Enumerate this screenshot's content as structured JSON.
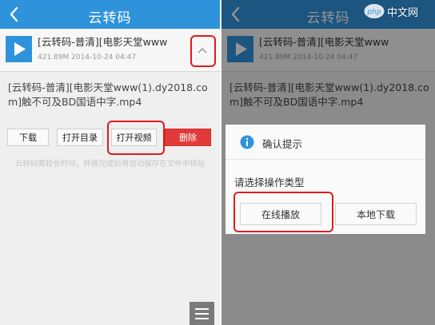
{
  "left_screen": {
    "title": "云转码",
    "file": {
      "name": "[云转码-普清][电影天堂www",
      "meta": "421.89M 2014-10-24 04:47",
      "full_name": "[云转码-普清][电影天堂www(1).dy2018.com]触不可及BD国语中字.mp4"
    },
    "buttons": {
      "download": "下载",
      "open_dir": "打开目录",
      "open_video": "打开视频",
      "delete": "删除"
    },
    "hint": "云转码需较长时间，转换完成后将自动保存在文件中转站"
  },
  "right_screen": {
    "title": "云转码",
    "file": {
      "name": "[云转码-普清][电影天堂www",
      "meta": "421.89M 2014-10-24 04:47",
      "full_name": "[云转码-普清][电影天堂www(1).dy2018.com]触不可及BD国语中字.mp4"
    },
    "dialog": {
      "title": "确认提示",
      "message": "请选择操作类型",
      "online_play": "在线播放",
      "local_download": "本地下载"
    }
  },
  "watermark": {
    "logo_text": "php",
    "site_text": "中文网"
  },
  "colors": {
    "title_bar": "#2f93dc",
    "delete_button": "#e23a3a",
    "highlight": "#e01b1b"
  }
}
